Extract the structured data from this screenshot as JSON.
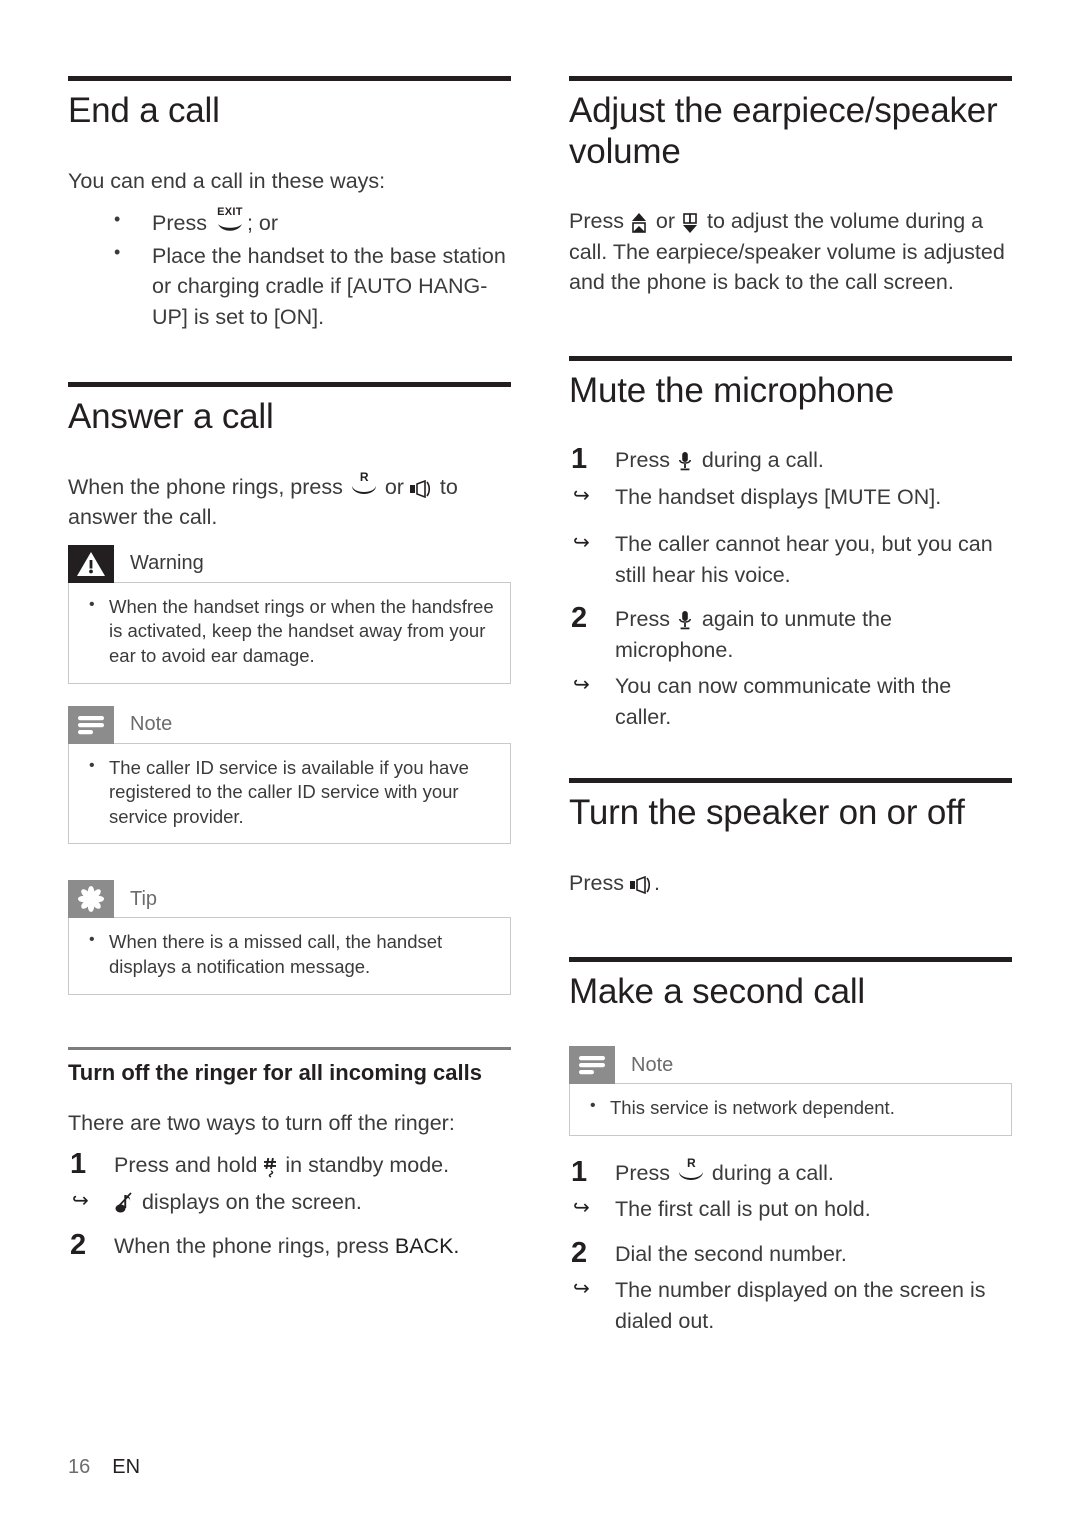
{
  "page": {
    "number": "16",
    "language": "EN"
  },
  "left_column": {
    "end_call": {
      "heading": "End a call",
      "intro": "You can end a call in these ways:",
      "bullets": [
        {
          "pre": "Press ",
          "icon": "hangup-exit-icon",
          "post": "; or"
        },
        {
          "pre": "Place the handset to the base station or charging cradle if [AUTO HANG-UP] is set to [ON].",
          "icon": "",
          "post": ""
        }
      ]
    },
    "answer_call": {
      "heading": "Answer a call",
      "para_pre": "When the phone rings, press ",
      "para_icon1": "talk-r-icon",
      "para_mid": " or ",
      "para_icon2": "speaker-icon",
      "para_post": " to answer the call.",
      "warning": {
        "label": "Warning",
        "icon": "warning-triangle-icon",
        "items": [
          "When the handset rings or when the handsfree is activated, keep the handset away from your ear to avoid ear damage."
        ]
      },
      "note": {
        "label": "Note",
        "icon": "note-lines-icon",
        "items": [
          "The caller ID service is available if you have registered to the caller ID service with your service provider."
        ]
      },
      "tip": {
        "label": "Tip",
        "icon": "tip-asterisk-icon",
        "items": [
          "When there is a missed call, the handset displays a notification message."
        ]
      }
    },
    "turn_off_ringer": {
      "heading": "Turn off the ringer for all incoming calls",
      "intro": "There are two ways to turn off the ringer:",
      "steps": [
        {
          "num": "1",
          "text_pre": "Press and hold ",
          "icon": "hash-key-icon",
          "text_post": " in standby mode.",
          "substeps": [
            {
              "icon": "ringer-off-note-icon",
              "text": " displays on the screen."
            }
          ]
        },
        {
          "num": "2",
          "text_pre": "When the phone rings, press ",
          "icon": "",
          "text_post": "BACK.",
          "substeps": []
        }
      ]
    }
  },
  "right_column": {
    "adjust_volume": {
      "heading": "Adjust the earpiece/speaker volume",
      "para_pre": "Press ",
      "para_icon1": "volume-up-icon",
      "para_mid": " or ",
      "para_icon2": "volume-down-icon",
      "para_post": " to adjust the volume during a call. The earpiece/speaker volume is adjusted and the phone is back to the call screen."
    },
    "mute_microphone": {
      "heading": "Mute the microphone",
      "steps": [
        {
          "num": "1",
          "text_pre": "Press ",
          "icon": "microphone-icon",
          "text_post": " during a call.",
          "substeps": [
            {
              "text": "The handset displays [MUTE ON]."
            },
            {
              "text": "The caller cannot hear you, but you can still hear his voice."
            }
          ]
        },
        {
          "num": "2",
          "text_pre": "Press ",
          "icon": "microphone-icon",
          "text_post": " again to unmute the microphone.",
          "substeps": [
            {
              "text": "You can now communicate with the caller."
            }
          ]
        }
      ]
    },
    "turn_speaker": {
      "heading": "Turn the speaker on or off",
      "para_pre": "Press ",
      "para_icon": "speaker-icon",
      "para_post": "."
    },
    "second_call": {
      "heading": "Make a second call",
      "note": {
        "label": "Note",
        "icon": "note-lines-icon",
        "items": [
          "This service is network dependent."
        ]
      },
      "steps": [
        {
          "num": "1",
          "text_pre": "Press ",
          "icon": "talk-r-icon",
          "text_post": " during a call.",
          "substeps": [
            {
              "text": "The first call is put on hold."
            }
          ]
        },
        {
          "num": "2",
          "text_pre": "Dial the second number.",
          "icon": "",
          "text_post": "",
          "substeps": [
            {
              "text": "The number displayed on the screen is dialed out."
            }
          ]
        }
      ]
    }
  },
  "colors": {
    "ink": "#231f20",
    "body_text": "#3b3b3b",
    "rule_major": "#231f20",
    "rule_minor": "#7d7d7d",
    "callout_gray": "#8c8c8c",
    "callout_border": "#c9c9c9",
    "label_gray": "#6c6c6c"
  }
}
